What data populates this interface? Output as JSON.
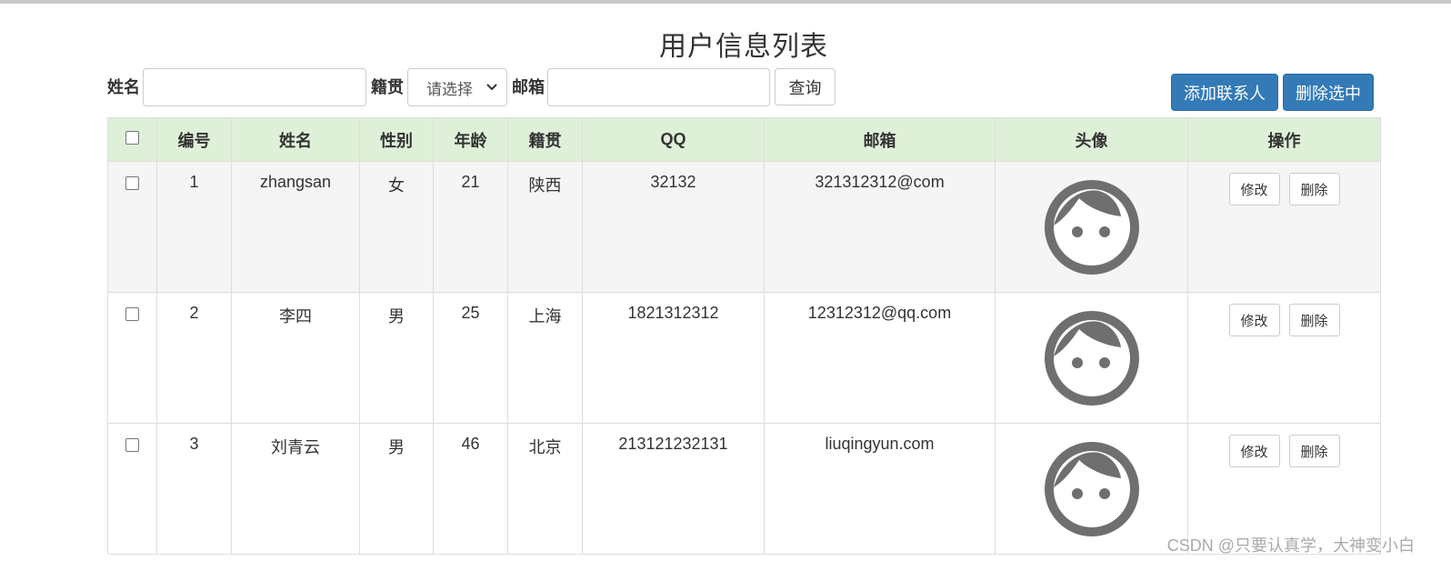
{
  "page": {
    "title": "用户信息列表"
  },
  "search": {
    "name_label": "姓名",
    "name_value": "",
    "origin_label": "籍贯",
    "origin_selected": "请选择",
    "email_label": "邮箱",
    "email_value": "",
    "query_button": "查询"
  },
  "actions": {
    "add_button": "添加联系人",
    "delete_selected_button": "删除选中"
  },
  "table": {
    "headers": [
      "编号",
      "姓名",
      "性别",
      "年龄",
      "籍贯",
      "QQ",
      "邮箱",
      "头像",
      "操作"
    ],
    "edit_label": "修改",
    "delete_label": "删除",
    "rows": [
      {
        "id": "1",
        "name": "zhangsan",
        "gender": "女",
        "age": "21",
        "origin": "陕西",
        "qq": "32132",
        "email": "321312312@com"
      },
      {
        "id": "2",
        "name": "李四",
        "gender": "男",
        "age": "25",
        "origin": "上海",
        "qq": "1821312312",
        "email": "12312312@qq.com"
      },
      {
        "id": "3",
        "name": "刘青云",
        "gender": "男",
        "age": "46",
        "origin": "北京",
        "qq": "213121232131",
        "email": "liuqingyun.com"
      }
    ]
  },
  "watermark": "CSDN @只要认真学，大神变小白",
  "icons": {
    "avatar": "avatar-face-icon",
    "select": "chevron-down-icon"
  },
  "colors": {
    "primary": "#337ab7",
    "header_bg": "#dff0d8",
    "stripe_bg": "#f5f5f5",
    "avatar": "#6f6f6f"
  }
}
